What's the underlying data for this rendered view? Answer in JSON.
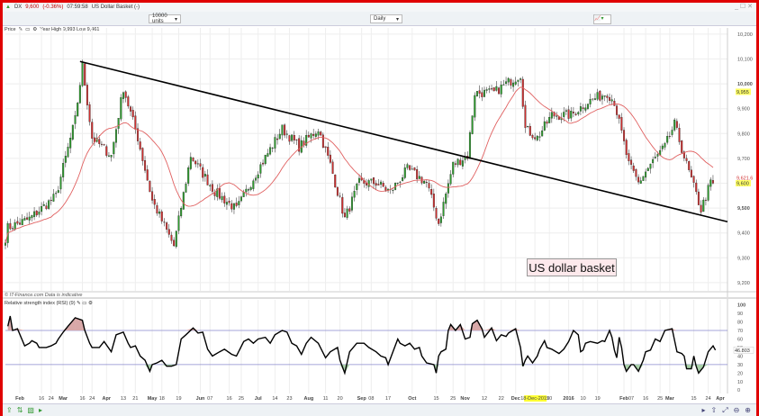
{
  "window": {
    "symbol": "DX",
    "price": "9,600",
    "change": "(-0.36%)",
    "time": "07:59:58",
    "name": "US Dollar Basket (-)",
    "controls": "_ ☐ ✕"
  },
  "toolbar": {
    "units": "10000 units",
    "period": "Daily"
  },
  "price_panel": {
    "label": "Price",
    "stats": "Year High 9,993 Low 9,461",
    "annotation": "US dollar basket"
  },
  "footer_note": "© IT-Finance.com  Data is indicative",
  "rsi_panel": {
    "label": "Relative strength index (RSI) (9)"
  },
  "colors": {
    "up": "#2e9e2e",
    "down": "#d03030",
    "ma": "#e06060",
    "trend": "#000000",
    "band": "#8888cc",
    "frame": "#e00000"
  },
  "chart_data": [
    {
      "type": "candlestick",
      "title": "US Dollar Basket",
      "x_unit": "trading day index",
      "xlim": [
        0,
        300
      ],
      "ylim": [
        9167,
        10225
      ],
      "y_ticks": [
        "10,200",
        "10,100",
        "10,000",
        "9,900",
        "9,800",
        "9,700",
        "9,600",
        "9,500",
        "9,400",
        "9,300",
        "9,200"
      ],
      "y_tick_values": [
        10200,
        10100,
        10000,
        9900,
        9800,
        9700,
        9600,
        9500,
        9400,
        9300,
        9200
      ],
      "bold_ticks": [
        10000,
        9500
      ],
      "price_labels": [
        {
          "text": "9,955",
          "value": 9968,
          "style": "highlight"
        },
        {
          "text": "9,621.6",
          "value": 9622,
          "style": "ma"
        },
        {
          "text": "9,600",
          "value": 9600,
          "style": "highlight"
        }
      ],
      "close_keypoints": [
        [
          0,
          9380
        ],
        [
          1,
          9421
        ],
        [
          10,
          9457
        ],
        [
          21,
          9548
        ],
        [
          29,
          9856
        ],
        [
          32,
          10073
        ],
        [
          36,
          9783
        ],
        [
          44,
          9711
        ],
        [
          49,
          9983
        ],
        [
          55,
          9783
        ],
        [
          61,
          9530
        ],
        [
          70,
          9348
        ],
        [
          77,
          9711
        ],
        [
          87,
          9566
        ],
        [
          96,
          9494
        ],
        [
          104,
          9638
        ],
        [
          115,
          9819
        ],
        [
          122,
          9747
        ],
        [
          130,
          9819
        ],
        [
          135,
          9675
        ],
        [
          141,
          9457
        ],
        [
          147,
          9602
        ],
        [
          154,
          9602
        ],
        [
          160,
          9566
        ],
        [
          167,
          9656
        ],
        [
          175,
          9602
        ],
        [
          180,
          9439
        ],
        [
          186,
          9675
        ],
        [
          192,
          9711
        ],
        [
          195,
          9964
        ],
        [
          203,
          9964
        ],
        [
          208,
          10000
        ],
        [
          214,
          10037
        ],
        [
          216,
          9819
        ],
        [
          221,
          9783
        ],
        [
          227,
          9874
        ],
        [
          235,
          9874
        ],
        [
          242,
          9928
        ],
        [
          250,
          9964
        ],
        [
          253,
          9928
        ],
        [
          259,
          9675
        ],
        [
          263,
          9602
        ],
        [
          268,
          9675
        ],
        [
          274,
          9747
        ],
        [
          278,
          9837
        ],
        [
          283,
          9675
        ],
        [
          289,
          9494
        ],
        [
          293,
          9602
        ],
        [
          294,
          9600
        ]
      ],
      "ma_period": 20,
      "trendline": [
        [
          31,
          10090
        ],
        [
          300,
          9445
        ]
      ]
    },
    {
      "type": "line",
      "title": "Relative strength index (RSI) (9)",
      "xlim": [
        0,
        300
      ],
      "ylim": [
        -4,
        106
      ],
      "y_ticks": [
        "100",
        "90",
        "80",
        "70",
        "60",
        "50",
        "40",
        "30",
        "20",
        "10",
        "0"
      ],
      "y_tick_values": [
        100,
        90,
        80,
        70,
        60,
        50,
        40,
        30,
        20,
        10,
        0
      ],
      "bands": [
        30,
        70
      ],
      "last_value_label": "46.803",
      "last_value": 47,
      "points": [
        [
          1,
          75
        ],
        [
          2,
          87
        ],
        [
          3,
          70
        ],
        [
          5,
          72
        ],
        [
          8,
          52
        ],
        [
          10,
          55
        ],
        [
          11,
          58
        ],
        [
          13,
          55
        ],
        [
          14,
          50
        ],
        [
          17,
          50
        ],
        [
          19,
          52
        ],
        [
          21,
          55
        ],
        [
          22,
          60
        ],
        [
          24,
          68
        ],
        [
          26,
          75
        ],
        [
          29,
          85
        ],
        [
          32,
          82
        ],
        [
          33,
          70
        ],
        [
          35,
          55
        ],
        [
          36,
          50
        ],
        [
          39,
          50
        ],
        [
          41,
          57
        ],
        [
          44,
          45
        ],
        [
          46,
          65
        ],
        [
          49,
          68
        ],
        [
          51,
          55
        ],
        [
          52,
          50
        ],
        [
          54,
          52
        ],
        [
          56,
          40
        ],
        [
          58,
          35
        ],
        [
          60,
          22
        ],
        [
          61,
          30
        ],
        [
          63,
          32
        ],
        [
          65,
          35
        ],
        [
          67,
          28
        ],
        [
          69,
          28
        ],
        [
          71,
          30
        ],
        [
          73,
          60
        ],
        [
          75,
          65
        ],
        [
          78,
          73
        ],
        [
          80,
          67
        ],
        [
          82,
          68
        ],
        [
          84,
          48
        ],
        [
          86,
          40
        ],
        [
          89,
          45
        ],
        [
          91,
          48
        ],
        [
          94,
          42
        ],
        [
          96,
          40
        ],
        [
          99,
          57
        ],
        [
          101,
          60
        ],
        [
          103,
          55
        ],
        [
          105,
          60
        ],
        [
          108,
          62
        ],
        [
          110,
          55
        ],
        [
          112,
          65
        ],
        [
          115,
          70
        ],
        [
          117,
          68
        ],
        [
          119,
          55
        ],
        [
          121,
          52
        ],
        [
          123,
          42
        ],
        [
          125,
          55
        ],
        [
          127,
          62
        ],
        [
          130,
          55
        ],
        [
          133,
          38
        ],
        [
          135,
          45
        ],
        [
          138,
          50
        ],
        [
          139,
          35
        ],
        [
          141,
          20
        ],
        [
          143,
          45
        ],
        [
          146,
          55
        ],
        [
          149,
          55
        ],
        [
          151,
          50
        ],
        [
          154,
          45
        ],
        [
          156,
          40
        ],
        [
          158,
          38
        ],
        [
          159,
          30
        ],
        [
          161,
          45
        ],
        [
          163,
          60
        ],
        [
          164,
          55
        ],
        [
          166,
          52
        ],
        [
          168,
          55
        ],
        [
          170,
          48
        ],
        [
          172,
          50
        ],
        [
          173,
          40
        ],
        [
          175,
          32
        ],
        [
          178,
          30
        ],
        [
          179,
          20
        ],
        [
          180,
          40
        ],
        [
          181,
          45
        ],
        [
          183,
          48
        ],
        [
          184,
          70
        ],
        [
          185,
          77
        ],
        [
          187,
          70
        ],
        [
          189,
          77
        ],
        [
          191,
          60
        ],
        [
          193,
          62
        ],
        [
          194,
          78
        ],
        [
          196,
          82
        ],
        [
          198,
          72
        ],
        [
          199,
          62
        ],
        [
          202,
          73
        ],
        [
          204,
          58
        ],
        [
          206,
          65
        ],
        [
          208,
          63
        ],
        [
          209,
          67
        ],
        [
          212,
          72
        ],
        [
          214,
          50
        ],
        [
          215,
          28
        ],
        [
          216,
          35
        ],
        [
          217,
          40
        ],
        [
          219,
          32
        ],
        [
          221,
          40
        ],
        [
          222,
          48
        ],
        [
          224,
          58
        ],
        [
          225,
          50
        ],
        [
          227,
          48
        ],
        [
          230,
          43
        ],
        [
          232,
          48
        ],
        [
          234,
          57
        ],
        [
          236,
          70
        ],
        [
          238,
          65
        ],
        [
          239,
          45
        ],
        [
          240,
          47
        ],
        [
          241,
          55
        ],
        [
          243,
          57
        ],
        [
          246,
          55
        ],
        [
          248,
          58
        ],
        [
          249,
          57
        ],
        [
          251,
          70
        ],
        [
          252,
          62
        ],
        [
          253,
          47
        ],
        [
          254,
          38
        ],
        [
          255,
          62
        ],
        [
          256,
          50
        ],
        [
          257,
          30
        ],
        [
          258,
          22
        ],
        [
          260,
          30
        ],
        [
          261,
          30
        ],
        [
          263,
          22
        ],
        [
          265,
          35
        ],
        [
          266,
          45
        ],
        [
          268,
          47
        ],
        [
          270,
          60
        ],
        [
          272,
          57
        ],
        [
          274,
          70
        ],
        [
          277,
          72
        ],
        [
          279,
          45
        ],
        [
          281,
          43
        ],
        [
          282,
          40
        ],
        [
          283,
          25
        ],
        [
          285,
          25
        ],
        [
          286,
          40
        ],
        [
          287,
          28
        ],
        [
          288,
          20
        ],
        [
          290,
          27
        ],
        [
          292,
          45
        ],
        [
          294,
          52
        ],
        [
          295,
          47
        ]
      ]
    }
  ],
  "x_axis": {
    "ticks": [
      {
        "label": "Feb",
        "day": 6,
        "bold": true
      },
      {
        "label": "16",
        "day": 15
      },
      {
        "label": "24",
        "day": 19
      },
      {
        "label": "Mar",
        "day": 24,
        "bold": true
      },
      {
        "label": "16",
        "day": 32
      },
      {
        "label": "24",
        "day": 36
      },
      {
        "label": "Apr",
        "day": 42,
        "bold": true
      },
      {
        "label": "13",
        "day": 49
      },
      {
        "label": "21",
        "day": 54
      },
      {
        "label": "May",
        "day": 61,
        "bold": true
      },
      {
        "label": "18",
        "day": 65
      },
      {
        "label": "19",
        "day": 72
      },
      {
        "label": "Jun",
        "day": 81,
        "bold": true
      },
      {
        "label": "07",
        "day": 85
      },
      {
        "label": "16",
        "day": 93
      },
      {
        "label": "25",
        "day": 98
      },
      {
        "label": "Jul",
        "day": 105,
        "bold": true
      },
      {
        "label": "14",
        "day": 112
      },
      {
        "label": "23",
        "day": 118
      },
      {
        "label": "Aug",
        "day": 126,
        "bold": true
      },
      {
        "label": "11",
        "day": 133
      },
      {
        "label": "20",
        "day": 139
      },
      {
        "label": "Sep",
        "day": 148,
        "bold": true
      },
      {
        "label": "08",
        "day": 152
      },
      {
        "label": "17",
        "day": 159
      },
      {
        "label": "Oct",
        "day": 169,
        "bold": true
      },
      {
        "label": "15",
        "day": 179
      },
      {
        "label": "25",
        "day": 186
      },
      {
        "label": "Nov",
        "day": 191,
        "bold": true
      },
      {
        "label": "12",
        "day": 199
      },
      {
        "label": "22",
        "day": 206
      },
      {
        "label": "Dec",
        "day": 212,
        "bold": true
      },
      {
        "label": "18-Dec-2015",
        "day": 220,
        "highlight": true
      },
      {
        "label": "20",
        "day": 226
      },
      {
        "label": "2016",
        "day": 234,
        "bold": true
      },
      {
        "label": "10",
        "day": 240
      },
      {
        "label": "19",
        "day": 246
      },
      {
        "label": "Feb",
        "day": 257,
        "bold": true
      },
      {
        "label": "07",
        "day": 260
      },
      {
        "label": "16",
        "day": 266
      },
      {
        "label": "25",
        "day": 272
      },
      {
        "label": "Mar",
        "day": 276,
        "bold": true
      },
      {
        "label": "15",
        "day": 286
      },
      {
        "label": "24",
        "day": 292
      },
      {
        "label": "Apr",
        "day": 297,
        "bold": true
      }
    ]
  }
}
